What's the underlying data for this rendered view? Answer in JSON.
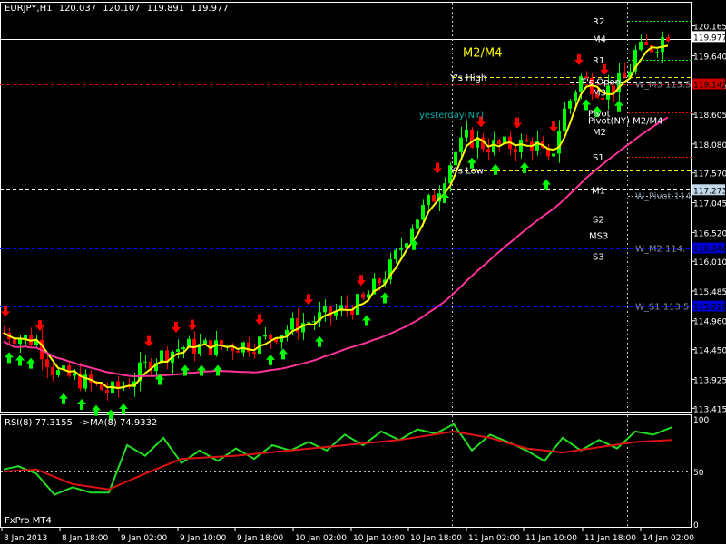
{
  "header": {
    "symbol": "EURJPY,H1",
    "open": "120.037",
    "high": "120.107",
    "low": "119.891",
    "close": "119.977"
  },
  "rsi_header": {
    "name": "RSI(8) 77.3155",
    "ma": "->MA(8) 74.9332"
  },
  "brand": "FxPro MT4",
  "colors": {
    "bull": "#00ff00",
    "bear": "#ff0000",
    "ma_fast": "#ffff00",
    "ma_slow": "#ff3399",
    "rsi": "#22dd22",
    "rsi_ma": "#dd1111",
    "grid": "#c0c0c0",
    "axis": "#ffffff"
  },
  "chart_data": {
    "type": "candlestick",
    "price_axis": {
      "ylim": [
        113.355,
        120.575
      ],
      "ticks": [
        "120.165",
        "119.640",
        "119.115",
        "118.605",
        "118.080",
        "117.570",
        "117.045",
        "116.520",
        "116.010",
        "115.485",
        "114.960",
        "114.450",
        "113.925",
        "113.415"
      ]
    },
    "time_axis": {
      "ticks": [
        "8 Jan 2013",
        "8 Jan 18:00",
        "9 Jan 02:00",
        "9 Jan 10:00",
        "9 Jan 18:00",
        "10 Jan 02:00",
        "10 Jan 10:00",
        "10 Jan 18:00",
        "11 Jan 02:00",
        "11 Jan 10:00",
        "11 Jan 18:00",
        "14 Jan 02:00"
      ]
    },
    "price_tags": [
      {
        "label": "119.977",
        "value": 119.977,
        "bg": "#ffffff",
        "fg": "#000000"
      },
      {
        "label": "119.142",
        "value": 119.142,
        "bg": "#cc0000",
        "fg": "#000000"
      },
      {
        "label": "117.273",
        "value": 117.273,
        "bg": "#c0d8e8",
        "fg": "#000000"
      },
      {
        "label": "116.244",
        "value": 116.244,
        "bg": "#0000cc",
        "fg": "#000000"
      },
      {
        "label": "115.219",
        "value": 115.219,
        "bg": "#0000cc",
        "fg": "#000000"
      }
    ],
    "levels": [
      {
        "name": "R2",
        "label": "R2",
        "value": 120.255,
        "color": "#00ff00",
        "style": "dot",
        "x0": 692,
        "x1": 762
      },
      {
        "name": "M4",
        "label": "M4",
        "value": 119.94,
        "color": "#ffffff",
        "style": "solid",
        "x0": 0,
        "x1": 762
      },
      {
        "name": "R1",
        "label": "R1",
        "value": 119.57,
        "color": "#00ff00",
        "style": "dot",
        "x0": 692,
        "x1": 762
      },
      {
        "name": "ys-high",
        "label": "Y's High",
        "value": 119.26,
        "color": "#ffff00",
        "style": "dash",
        "x0": 498,
        "x1": 762
      },
      {
        "name": "ts-open",
        "label": "T's Open",
        "value": 119.19,
        "color": "#ffffff",
        "style": "dash",
        "x0": 628,
        "x1": 762
      },
      {
        "name": "w-m3",
        "label": "W_M3 115.5",
        "value": 119.142,
        "color": "#cc0000",
        "style": "dash",
        "x0": 0,
        "x1": 762
      },
      {
        "name": "m3",
        "label": "M3",
        "value": 119.0,
        "color": "#ffffff",
        "style": "none",
        "x0": 692,
        "x1": 762
      },
      {
        "name": "pivot",
        "label": "Pivot",
        "value": 118.63,
        "color": "#ff0000",
        "style": "dot",
        "x0": 692,
        "x1": 762
      },
      {
        "name": "m2",
        "label": "M2",
        "value": 118.3,
        "color": "#ffffff",
        "style": "none",
        "x0": 692,
        "x1": 762
      },
      {
        "name": "pivot-ny",
        "label": "Pivot(NY) M2/M4",
        "value": 118.5,
        "color": "#ff0000",
        "style": "dot",
        "x0": 692,
        "x1": 762
      },
      {
        "name": "s1",
        "label": "S1",
        "value": 117.85,
        "color": "#ff0000",
        "style": "dot",
        "x0": 692,
        "x1": 762
      },
      {
        "name": "ys-low",
        "label": "Y's Low",
        "value": 117.62,
        "color": "#ffff00",
        "style": "dash",
        "x0": 498,
        "x1": 762
      },
      {
        "name": "m1",
        "label": "M1",
        "value": 117.273,
        "color": "#ffffff",
        "style": "dash",
        "x0": 0,
        "x1": 762
      },
      {
        "name": "w-pivot",
        "label": "W_Pivot 114",
        "value": 117.17,
        "color": "#c0c0c0",
        "style": "dot",
        "x0": 692,
        "x1": 762
      },
      {
        "name": "s2",
        "label": "S2",
        "value": 116.76,
        "color": "#ff0000",
        "style": "dot",
        "x0": 692,
        "x1": 762
      },
      {
        "name": "ms3",
        "label": "MS3",
        "value": 116.47,
        "color": "#ffffff",
        "style": "none",
        "x0": 692,
        "x1": 762
      },
      {
        "name": "s3-line",
        "label": "",
        "value": 116.6,
        "color": "#00ff00",
        "style": "dot",
        "x0": 692,
        "x1": 762
      },
      {
        "name": "w-m2",
        "label": "W_M2 114.",
        "value": 116.244,
        "color": "#0000ff",
        "style": "dash",
        "x0": 0,
        "x1": 762
      },
      {
        "name": "s3",
        "label": "S3",
        "value": 116.1,
        "color": "#ffffff",
        "style": "none",
        "x0": 692,
        "x1": 762
      },
      {
        "name": "w-s1",
        "label": "W_S1 113.5",
        "value": 115.219,
        "color": "#0000ff",
        "style": "dash",
        "x0": 0,
        "x1": 762
      }
    ],
    "annotations": [
      {
        "name": "m2-m4-label",
        "text": "M2/M4",
        "value": 119.705,
        "x": 510,
        "color": "#ffff00",
        "size": 13
      },
      {
        "name": "yesterday-ny",
        "text": "yesterday(NY)",
        "value": 118.62,
        "x": 462,
        "color": "#00aaaa",
        "size": 10
      }
    ],
    "vlines": [
      {
        "x": 498
      },
      {
        "x": 691
      }
    ],
    "rsi": {
      "ylim": [
        0,
        100
      ],
      "ticks": [
        "100",
        "50",
        "0"
      ],
      "levels": [
        50
      ]
    }
  }
}
